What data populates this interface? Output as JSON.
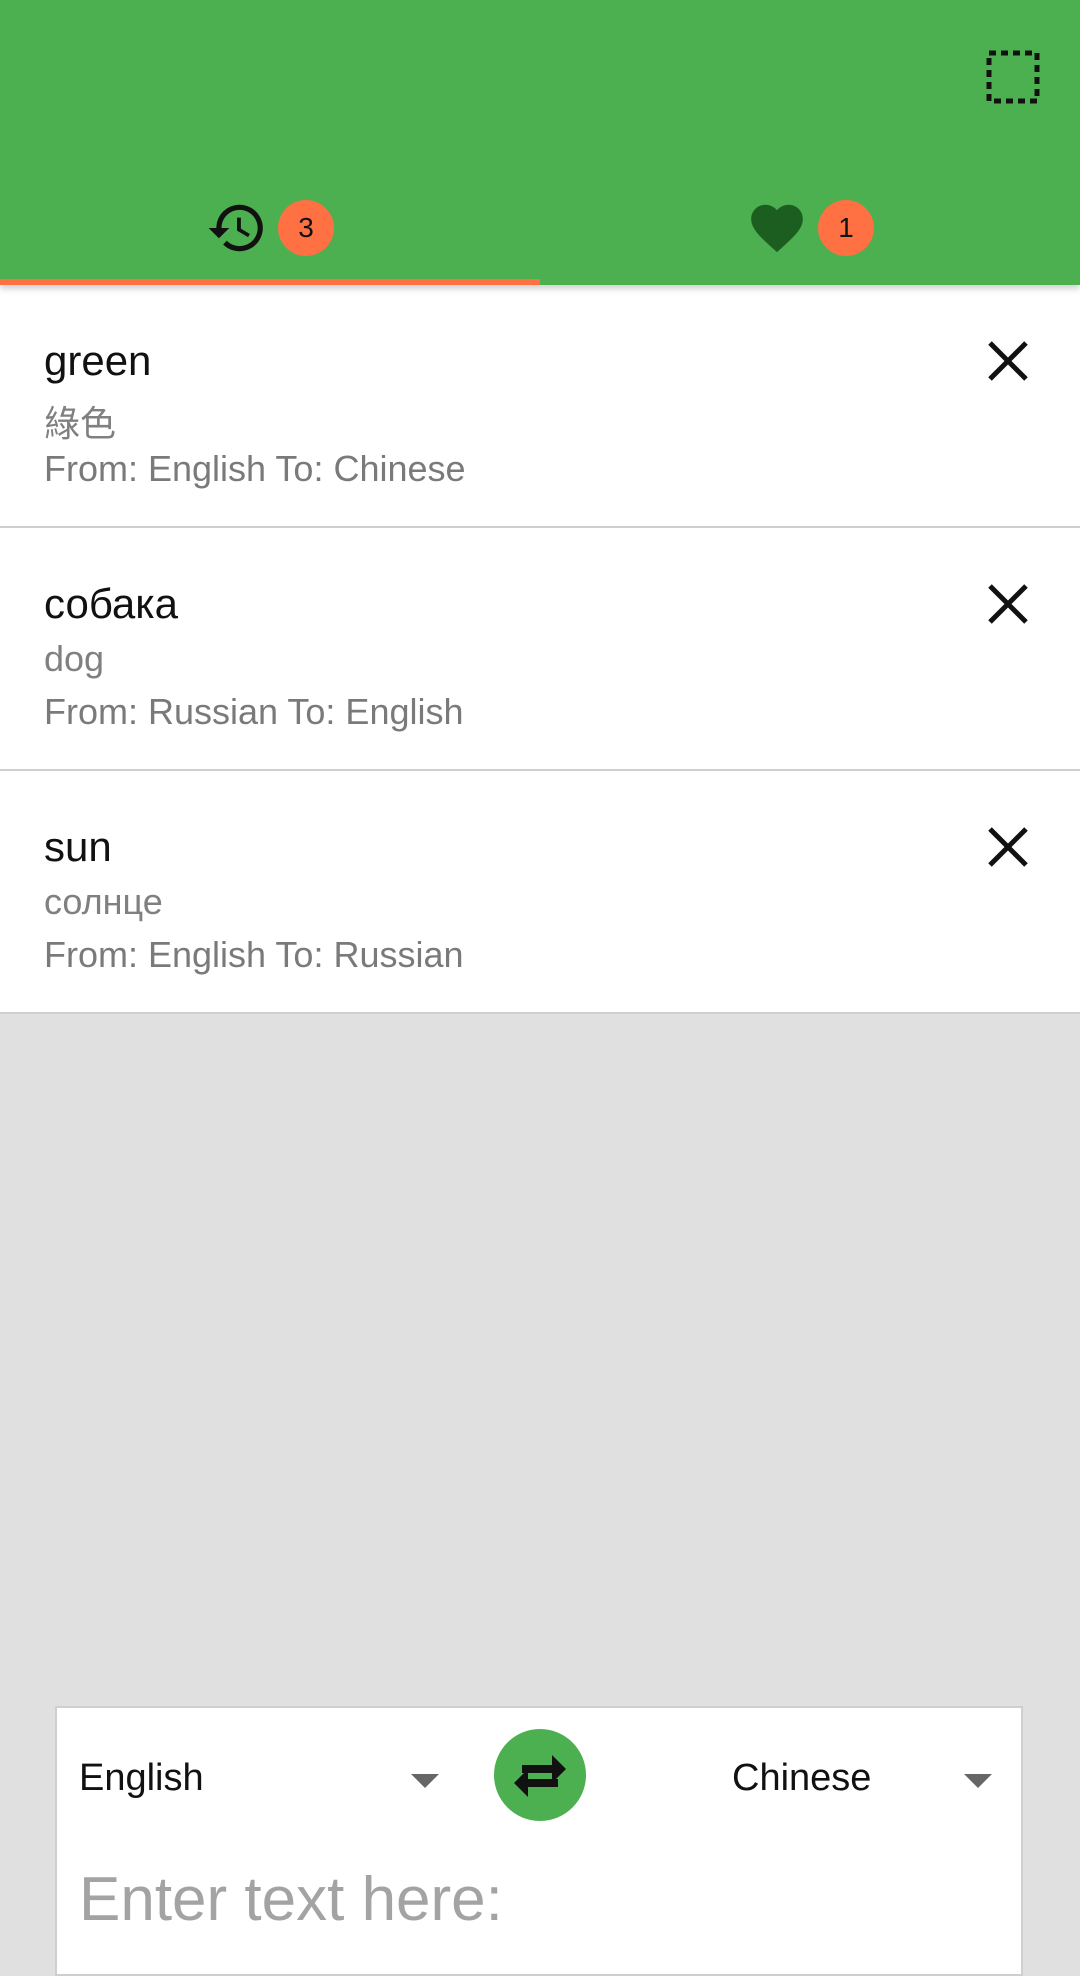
{
  "app_bar": {
    "select_icon": "select-all-icon",
    "color": "#4caf50"
  },
  "tabs": [
    {
      "name": "history",
      "icon": "history-icon",
      "badge": "3",
      "active": true
    },
    {
      "name": "favorites",
      "icon": "heart-icon",
      "badge": "1",
      "active": false
    }
  ],
  "history": [
    {
      "word": "green",
      "translation": "綠色",
      "langs": "From: English To: Chinese"
    },
    {
      "word": "собака",
      "translation": "dog",
      "langs": "From: Russian To: English"
    },
    {
      "word": "sun",
      "translation": "солнце",
      "langs": "From: English To: Russian"
    }
  ],
  "translator": {
    "from_lang": "English",
    "to_lang": "Chinese",
    "input_placeholder": "Enter text here:",
    "swap_icon": "swap-arrows-icon"
  },
  "colors": {
    "primary": "#4caf50",
    "accent": "#ff7043",
    "heart": "#1b5e20"
  }
}
